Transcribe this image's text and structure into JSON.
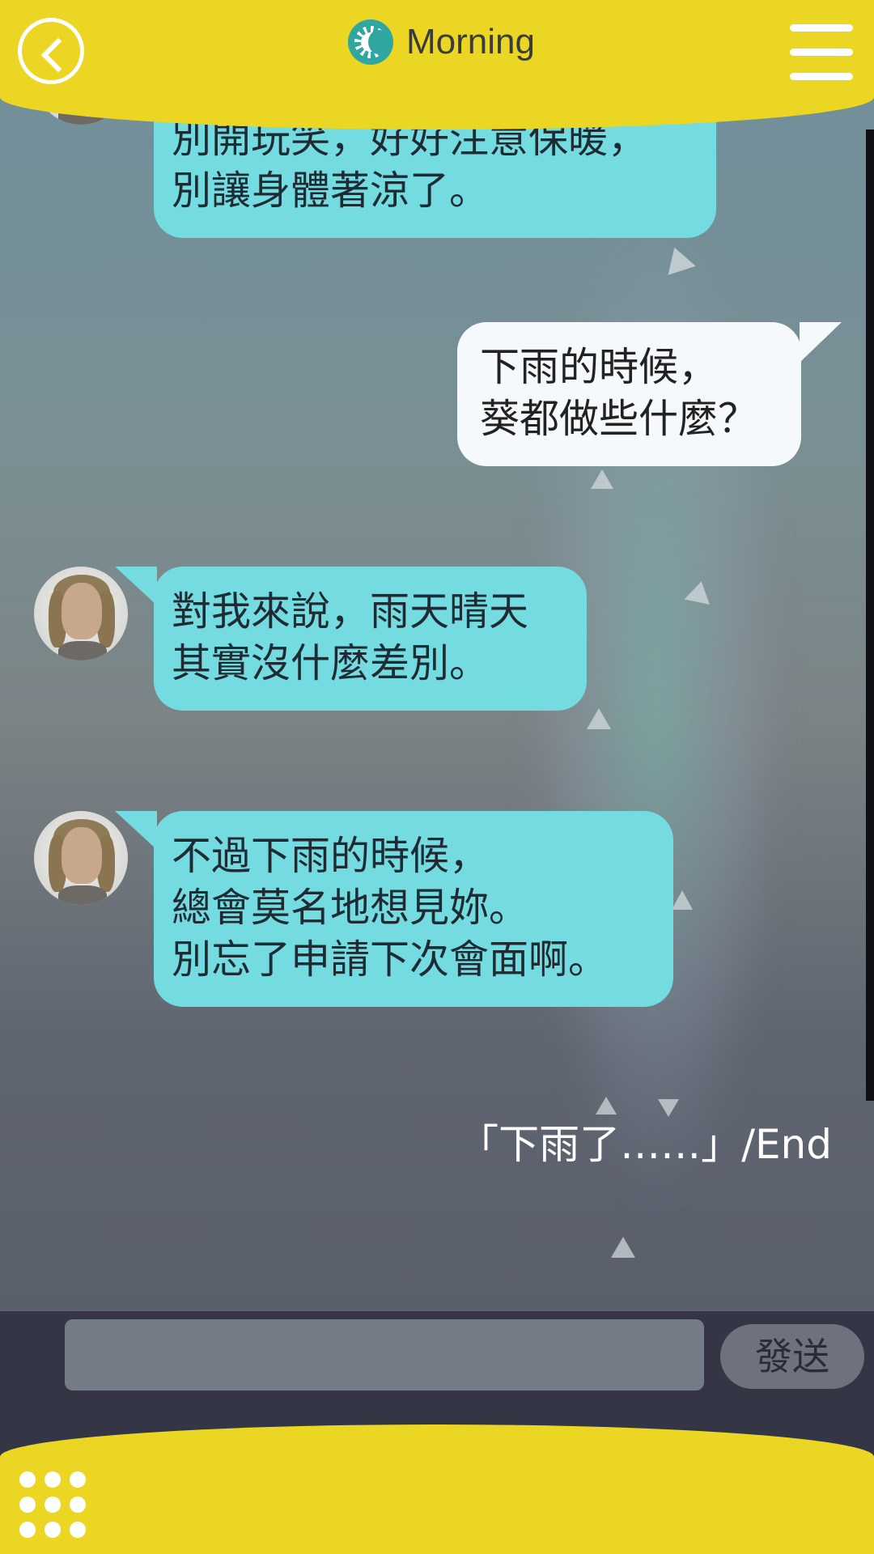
{
  "header": {
    "title": "Morning"
  },
  "messages": [
    {
      "sender": "character",
      "lines": [
        "別開玩笑，好好注意保暖，",
        "別讓身體著涼了。"
      ]
    },
    {
      "sender": "user",
      "lines": [
        "下雨的時候，",
        "葵都做些什麼？"
      ]
    },
    {
      "sender": "character",
      "lines": [
        "對我來說，雨天晴天",
        "其實沒什麼差別。"
      ]
    },
    {
      "sender": "character",
      "lines": [
        "不過下雨的時候，",
        "總會莫名地想見妳。",
        "別忘了申請下次會面啊。"
      ]
    }
  ],
  "end_text": "「下雨了……」/End",
  "input": {
    "value": "",
    "placeholder": ""
  },
  "send_label": "發送",
  "icons": {
    "back": "back-arrow-icon",
    "sun": "sun-icon",
    "menu": "hamburger-menu-icon",
    "grid": "grid-menu-icon"
  },
  "colors": {
    "header_yellow": "#ecd624",
    "bubble_character": "#74dbe0",
    "bubble_user": "#f6f9fb",
    "input_bar": "#343646"
  }
}
